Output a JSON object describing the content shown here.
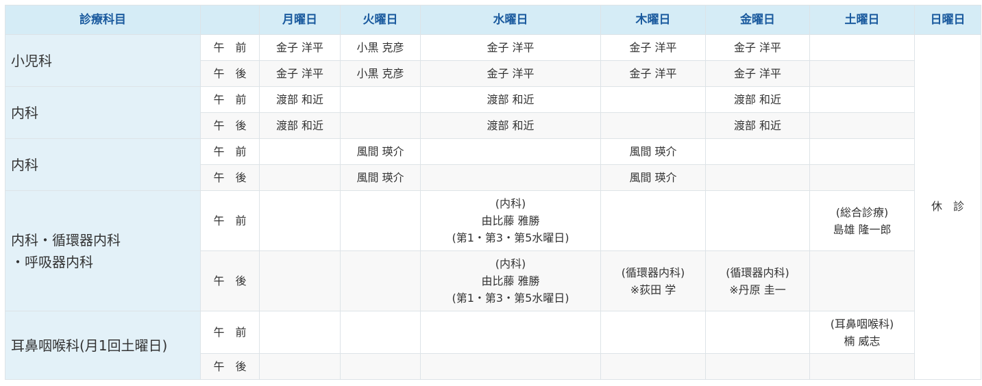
{
  "header": {
    "dept": "診療科目",
    "session": "",
    "days": [
      "月曜日",
      "火曜日",
      "水曜日",
      "木曜日",
      "金曜日",
      "土曜日",
      "日曜日"
    ]
  },
  "session_labels": {
    "am": "午　前",
    "pm": "午　後"
  },
  "sunday_note": "休　診",
  "departments": [
    {
      "name": "小児科",
      "am": [
        "金子 洋平",
        "小黒 克彦",
        "金子 洋平",
        "金子 洋平",
        "金子 洋平",
        ""
      ],
      "pm": [
        "金子 洋平",
        "小黒 克彦",
        "金子 洋平",
        "金子 洋平",
        "金子 洋平",
        ""
      ]
    },
    {
      "name": "内科",
      "am": [
        "渡部 和近",
        "",
        "渡部 和近",
        "",
        "渡部 和近",
        ""
      ],
      "pm": [
        "渡部 和近",
        "",
        "渡部 和近",
        "",
        "渡部 和近",
        ""
      ]
    },
    {
      "name": "内科",
      "am": [
        "",
        "風間 瑛介",
        "",
        "風間 瑛介",
        "",
        ""
      ],
      "pm": [
        "",
        "風間 瑛介",
        "",
        "風間 瑛介",
        "",
        ""
      ]
    },
    {
      "name_line1": "内科・循環器内科",
      "name_line2": "・呼吸器内科",
      "am_wed": [
        "(内科)",
        "由比藤 雅勝",
        "(第1・第3・第5水曜日)"
      ],
      "am_sat": [
        "(総合診療)",
        "島雄 隆一郎"
      ],
      "pm_wed": [
        "(内科)",
        "由比藤 雅勝",
        "(第1・第3・第5水曜日)"
      ],
      "pm_thu": [
        "(循環器内科)",
        "※荻田 学"
      ],
      "pm_fri": [
        "(循環器内科)",
        "※丹原 圭一"
      ]
    },
    {
      "name": "耳鼻咽喉科(月1回土曜日)",
      "am_sat": [
        "(耳鼻咽喉科)",
        "楠 威志"
      ]
    }
  ]
}
